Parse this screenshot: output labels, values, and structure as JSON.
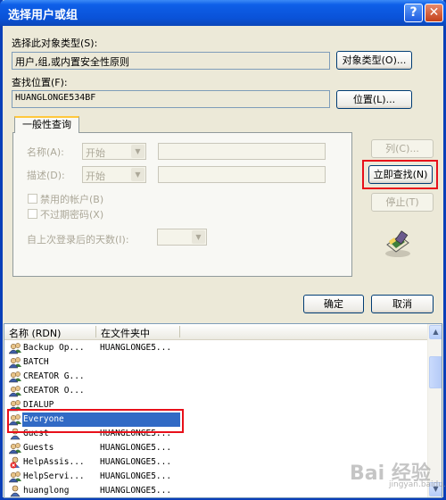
{
  "title": "选择用户或组",
  "titlebar_buttons": {
    "help": "?",
    "close": "✕"
  },
  "object_type": {
    "label": "选择此对象类型(S):",
    "value": "用户,组,或内置安全性原则",
    "button": "对象类型(O)..."
  },
  "location": {
    "label": "查找位置(F):",
    "value": "HUANGLONGE534BF",
    "button": "位置(L)..."
  },
  "tab_label": "一般性查询",
  "query": {
    "name_label": "名称(A):",
    "name_op": "开始",
    "desc_label": "描述(D):",
    "desc_op": "开始",
    "disabled_accounts": "禁用的帐户(B)",
    "no_expire_password": "不过期密码(X)",
    "days_label": "自上次登录后的天数(I):"
  },
  "side_buttons": {
    "columns": "列(C)...",
    "find_now": "立即查找(N)",
    "stop": "停止(T)"
  },
  "ok": "确定",
  "cancel": "取消",
  "list": {
    "columns": [
      "名称 (RDN)",
      "在文件夹中"
    ],
    "rows": [
      {
        "name": "Backup Op...",
        "folder": "HUANGLONGE5...",
        "icon": "group-icon"
      },
      {
        "name": "BATCH",
        "folder": "",
        "icon": "group-icon"
      },
      {
        "name": "CREATOR G...",
        "folder": "",
        "icon": "group-icon"
      },
      {
        "name": "CREATOR O...",
        "folder": "",
        "icon": "group-icon"
      },
      {
        "name": "DIALUP",
        "folder": "",
        "icon": "group-icon"
      },
      {
        "name": "Everyone",
        "folder": "",
        "icon": "group-icon",
        "selected": true
      },
      {
        "name": "Guest",
        "folder": "HUANGLONGE5...",
        "icon": "user-icon"
      },
      {
        "name": "Guests",
        "folder": "HUANGLONGE5...",
        "icon": "group-icon"
      },
      {
        "name": "HelpAssis...",
        "folder": "HUANGLONGE5...",
        "icon": "disabled-user-icon"
      },
      {
        "name": "HelpServi...",
        "folder": "HUANGLONGE5...",
        "icon": "group-icon"
      },
      {
        "name": "huanglong",
        "folder": "HUANGLONGE5...",
        "icon": "user-icon"
      }
    ]
  },
  "watermark": {
    "brand": "Bai 经验",
    "url": "jingyan.baidu.com"
  },
  "colors": {
    "titlebar": "#0A52D8",
    "highlight": "#E8101A",
    "selection": "#316AC5",
    "dialog": "#ECE9D8"
  }
}
